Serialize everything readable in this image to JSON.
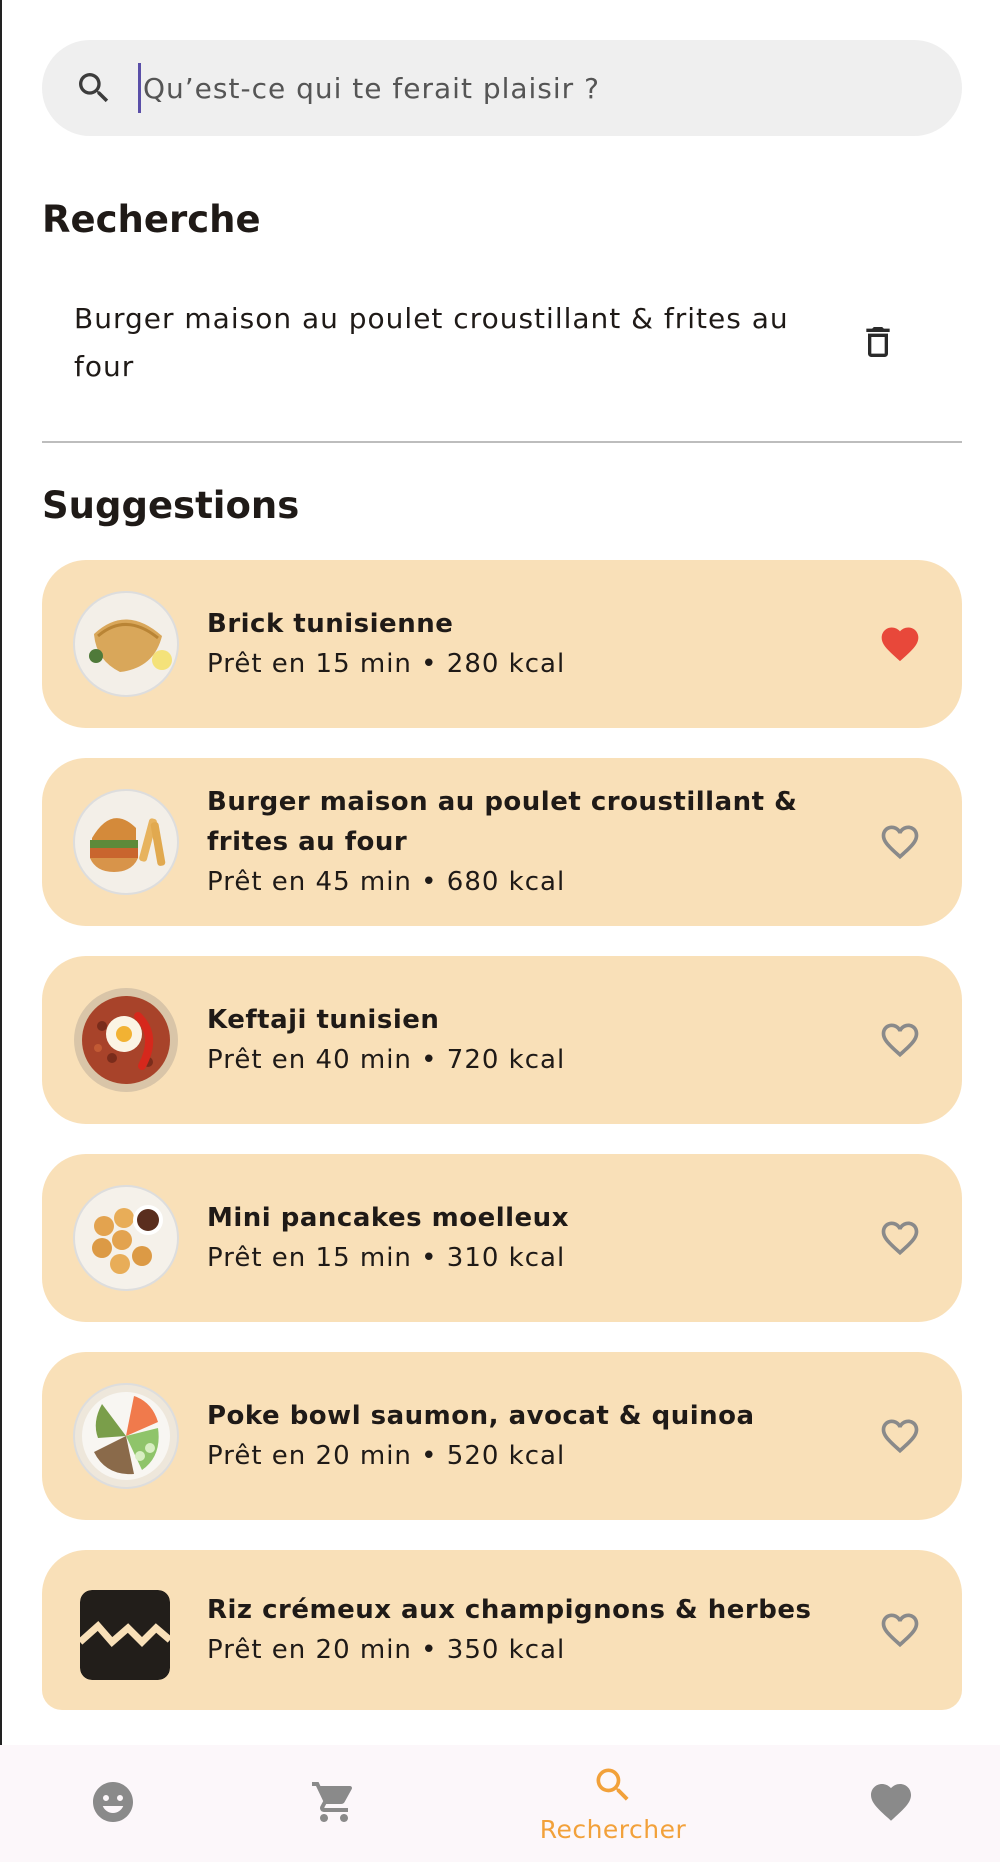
{
  "search": {
    "placeholder": "Qu’est-ce qui te ferait plaisir ?"
  },
  "recent": {
    "title": "Recherche",
    "items": [
      {
        "text": "Burger maison au poulet croustillant & frites au four"
      }
    ]
  },
  "suggestions": {
    "title": "Suggestions",
    "items": [
      {
        "title": "Brick tunisienne",
        "meta": "Prêt en 15 min • 280 kcal",
        "favorite": true
      },
      {
        "title": "Burger maison au poulet croustillant & frites au four",
        "meta": "Prêt en 45 min • 680 kcal",
        "favorite": false
      },
      {
        "title": "Keftaji tunisien",
        "meta": "Prêt en 40 min • 720 kcal",
        "favorite": false
      },
      {
        "title": "Mini pancakes moelleux",
        "meta": "Prêt en 15 min • 310 kcal",
        "favorite": false
      },
      {
        "title": "Poke bowl saumon, avocat & quinoa",
        "meta": "Prêt en 20 min • 520 kcal",
        "favorite": false
      },
      {
        "title": "Riz crémeux aux champignons & herbes",
        "meta": "Prêt en 20 min • 350 kcal",
        "favorite": false
      }
    ]
  },
  "nav": {
    "items": [
      {
        "icon": "mood-icon"
      },
      {
        "icon": "cart-icon"
      },
      {
        "icon": "search-icon",
        "label": "Rechercher",
        "active": true
      },
      {
        "icon": "heart-icon"
      }
    ]
  },
  "colors": {
    "card": "#f9e0b8",
    "accent": "#f2a13a",
    "favorite": "#e8483a",
    "icon": "#8a8a8a"
  }
}
